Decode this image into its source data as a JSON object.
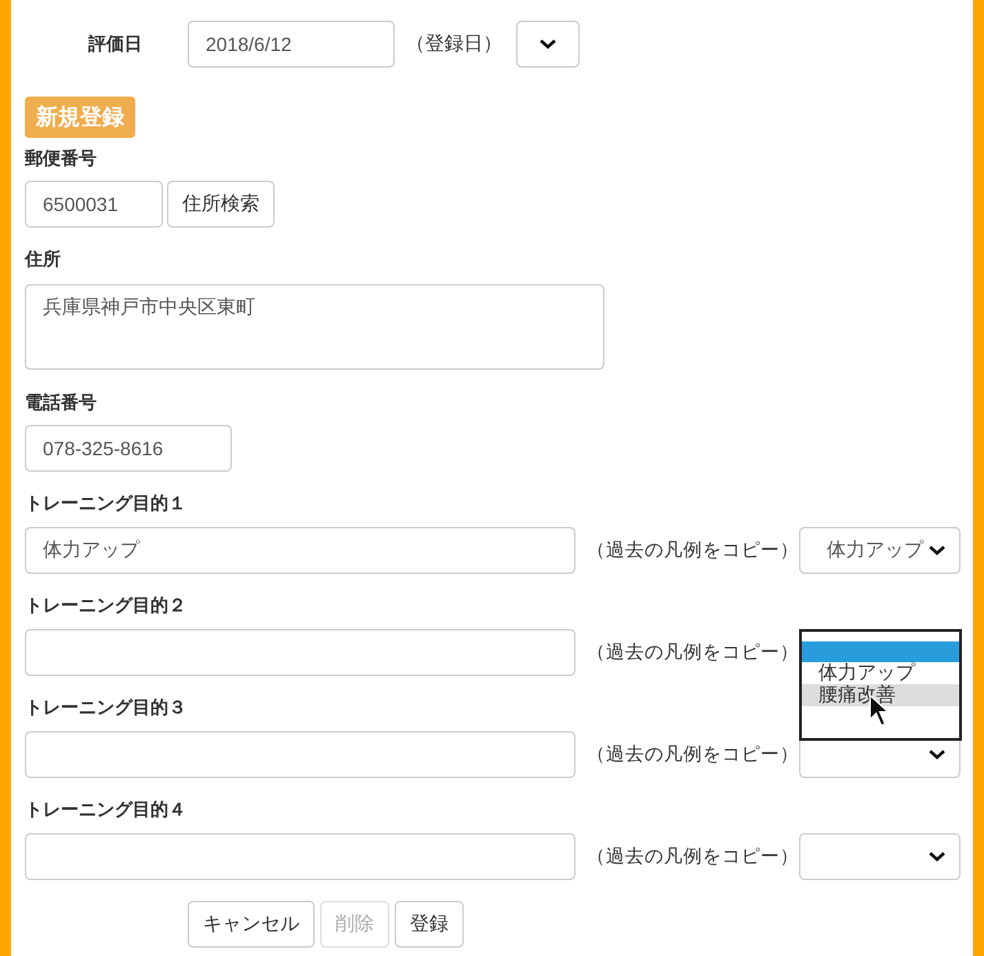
{
  "evaluation": {
    "label": "評価日",
    "value": "2018/6/12",
    "note": "（登録日）"
  },
  "badge": "新規登録",
  "postal": {
    "label": "郵便番号",
    "value": "6500031",
    "button": "住所検索"
  },
  "address": {
    "label": "住所",
    "value": "兵庫県神戸市中央区東町"
  },
  "phone": {
    "label": "電話番号",
    "value": "078-325-8616"
  },
  "goals": [
    {
      "label": "トレーニング目的１",
      "value": "体力アップ",
      "copy_label": "（過去の凡例をコピー）",
      "select_value": "体力アップ",
      "open": false
    },
    {
      "label": "トレーニング目的２",
      "copy_label": "（過去の凡例をコピー）",
      "open": true,
      "blank_highlighted": true,
      "options": [
        {
          "label": "体力アップ",
          "hovered": false
        },
        {
          "label": "腰痛改善",
          "hovered": true
        }
      ]
    },
    {
      "label": "トレーニング目的３",
      "copy_label": "（過去の凡例をコピー）",
      "open": false
    },
    {
      "label": "トレーニング目的４",
      "copy_label": "（過去の凡例をコピー）",
      "open": false
    }
  ],
  "buttons": [
    {
      "label": "キャンセル",
      "disabled": false
    },
    {
      "label": "削除",
      "disabled": true
    },
    {
      "label": "登録",
      "disabled": false
    }
  ]
}
